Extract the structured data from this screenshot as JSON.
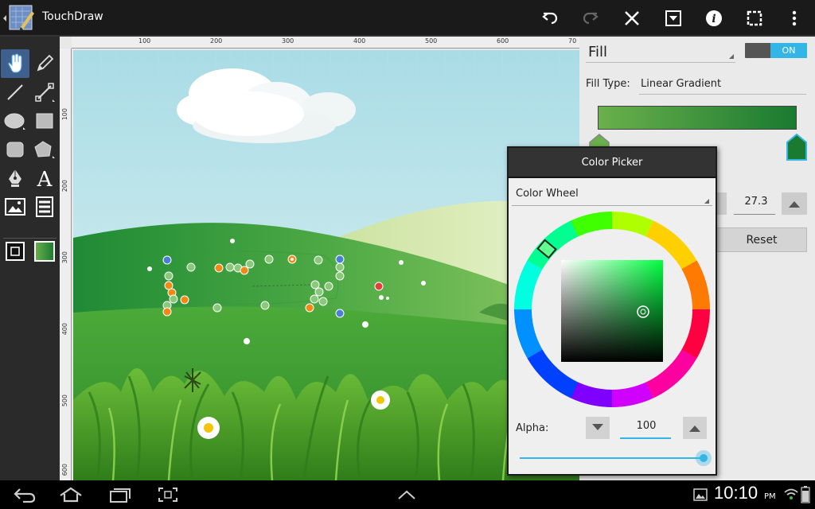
{
  "app": {
    "title": "TouchDraw",
    "icon": "touchdraw-app-icon"
  },
  "actionbar": {
    "icons": [
      "undo-icon",
      "redo-icon",
      "close-icon",
      "dropdown-menu-icon",
      "info-icon",
      "selection-icon",
      "overflow-menu-icon"
    ]
  },
  "rulers": {
    "horizontal": [
      "100",
      "200",
      "300",
      "400",
      "500",
      "600",
      "70"
    ],
    "vertical": [
      "100",
      "200",
      "300",
      "400",
      "500",
      "600"
    ]
  },
  "tools": [
    "hand-pan-tool",
    "pencil-tool",
    "line-tool",
    "connector-tool",
    "ellipse-tool",
    "rectangle-tool",
    "rounded-rectangle-tool",
    "polygon-tool",
    "pen-tool",
    "text-tool",
    "image-tool",
    "table-tool",
    "stroke-color-swatch",
    "fill-color-swatch"
  ],
  "fill_panel": {
    "title": "Fill",
    "toggle": "ON",
    "fill_type_label": "Fill Type:",
    "fill_type_value": "Linear Gradient",
    "gradient_colors": [
      "#6ab04c",
      "#1a7a30"
    ],
    "angle_value": "27.3",
    "reset_label": "Reset"
  },
  "color_picker": {
    "title": "Color Picker",
    "mode": "Color Wheel",
    "alpha_label": "Alpha:",
    "alpha_value": "100",
    "alpha_fraction": 1.0,
    "selected_hue_color": "#00ff40"
  },
  "system": {
    "time": "10:10",
    "ampm": "PM",
    "nav_icons": [
      "back-icon",
      "home-icon",
      "recent-apps-icon",
      "screenshot-icon",
      "chevron-up-icon"
    ],
    "status_icons": [
      "gallery-notification-icon",
      "wifi-icon",
      "battery-icon"
    ]
  },
  "colors": {
    "accent": "#33b5e5",
    "toolbar": "#2a2a2a",
    "actionbar": "#1a1a1a"
  }
}
